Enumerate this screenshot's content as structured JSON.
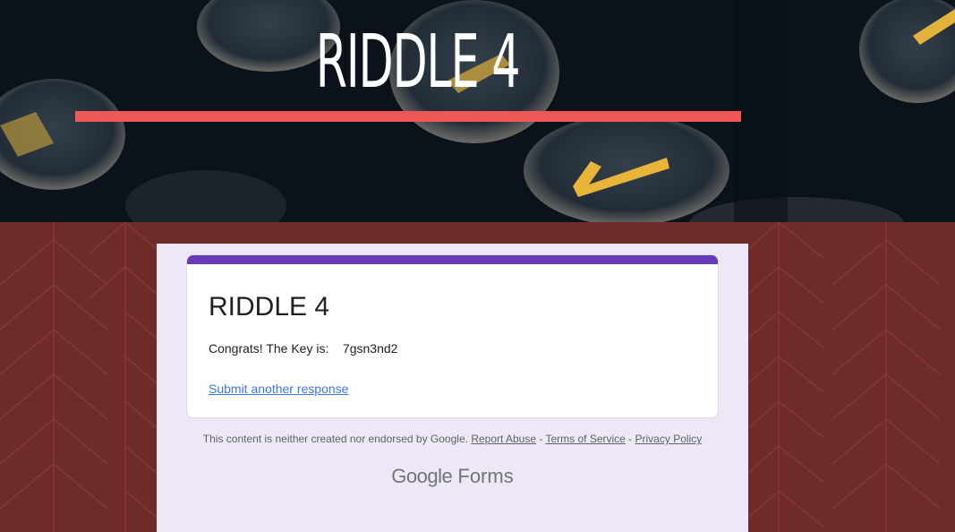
{
  "banner": {
    "title": "RIDDLE 4",
    "bar_color": "#f05858"
  },
  "form": {
    "title": "RIDDLE 4",
    "accent_color": "#673ab7",
    "confirmation_message": "Congrats! The Key is:    7gsn3nd2",
    "submit_another_label": "Submit another response"
  },
  "footer": {
    "disclaimer_text": "This content is neither created nor endorsed by Google.",
    "report_abuse_label": "Report Abuse",
    "separator": " - ",
    "terms_label": "Terms of Service",
    "privacy_label": "Privacy Policy"
  },
  "brand": {
    "google_label": "Google",
    "forms_label": "Forms"
  }
}
